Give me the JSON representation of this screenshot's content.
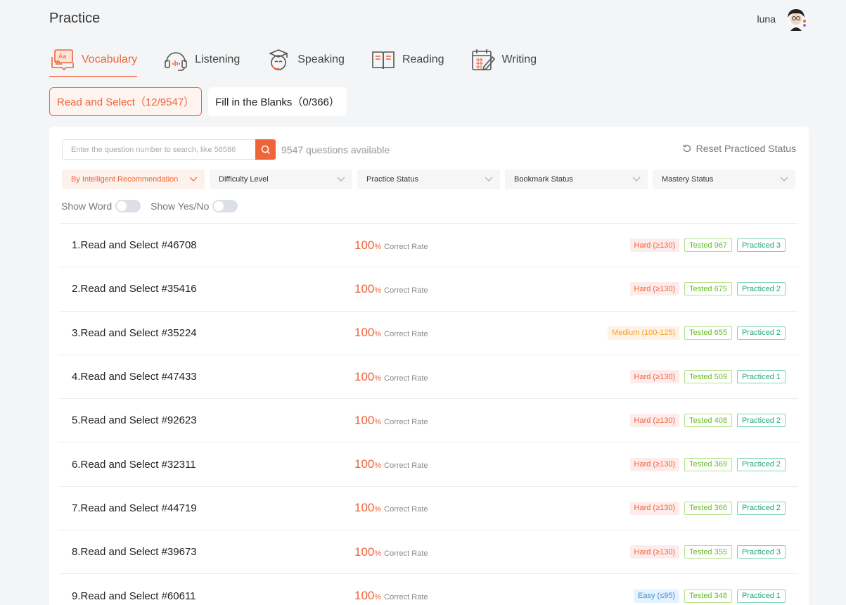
{
  "page_title": "Practice",
  "user": {
    "name": "luna"
  },
  "skill_tabs": [
    {
      "label": "Vocabulary",
      "icon": "vocabulary-book-icon"
    },
    {
      "label": "Listening",
      "icon": "headphones-icon"
    },
    {
      "label": "Speaking",
      "icon": "graduate-speaking-icon"
    },
    {
      "label": "Reading",
      "icon": "open-book-icon"
    },
    {
      "label": "Writing",
      "icon": "calendar-pen-icon"
    }
  ],
  "sub_tabs": [
    {
      "label": "Read and Select（12/9547）"
    },
    {
      "label": "Fill in the Blanks（0/366）"
    }
  ],
  "search": {
    "placeholder": "Enter the question number to search, like 56586",
    "available_text": "9547 questions available"
  },
  "reset_label": "Reset Practiced Status",
  "filters": [
    {
      "label": "By Intelligent Recommendation"
    },
    {
      "label": "Difficulty Level"
    },
    {
      "label": "Practice Status"
    },
    {
      "label": "Bookmark Status"
    },
    {
      "label": "Mastery Status"
    }
  ],
  "toggles": [
    {
      "label": "Show Word"
    },
    {
      "label": "Show Yes/No"
    }
  ],
  "rate_suffix": "%",
  "rate_text": "Correct Rate",
  "questions": [
    {
      "title": "1.Read and Select #46708",
      "rate": "100",
      "difficulty": "Hard (≥130)",
      "level": "hard",
      "tested": "Tested 967",
      "practiced": "Practiced 3"
    },
    {
      "title": "2.Read and Select #35416",
      "rate": "100",
      "difficulty": "Hard (≥130)",
      "level": "hard",
      "tested": "Tested 675",
      "practiced": "Practiced 2"
    },
    {
      "title": "3.Read and Select #35224",
      "rate": "100",
      "difficulty": "Medium (100-125)",
      "level": "medium",
      "tested": "Tested 655",
      "practiced": "Practiced 2"
    },
    {
      "title": "4.Read and Select #47433",
      "rate": "100",
      "difficulty": "Hard (≥130)",
      "level": "hard",
      "tested": "Tested 509",
      "practiced": "Practiced 1"
    },
    {
      "title": "5.Read and Select #92623",
      "rate": "100",
      "difficulty": "Hard (≥130)",
      "level": "hard",
      "tested": "Tested 408",
      "practiced": "Practiced 2"
    },
    {
      "title": "6.Read and Select #32311",
      "rate": "100",
      "difficulty": "Hard (≥130)",
      "level": "hard",
      "tested": "Tested 369",
      "practiced": "Practiced 2"
    },
    {
      "title": "7.Read and Select #44719",
      "rate": "100",
      "difficulty": "Hard (≥130)",
      "level": "hard",
      "tested": "Tested 366",
      "practiced": "Practiced 2"
    },
    {
      "title": "8.Read and Select #39673",
      "rate": "100",
      "difficulty": "Hard (≥130)",
      "level": "hard",
      "tested": "Tested 355",
      "practiced": "Practiced 3"
    },
    {
      "title": "9.Read and Select #60611",
      "rate": "100",
      "difficulty": "Easy (≤95)",
      "level": "easy",
      "tested": "Tested 348",
      "practiced": "Practiced 1"
    }
  ],
  "colors": {
    "accent": "#f0643a",
    "tested": "#66bb22",
    "practiced": "#20a878",
    "medium": "#f5a12a",
    "easy": "#3d8fe0"
  }
}
